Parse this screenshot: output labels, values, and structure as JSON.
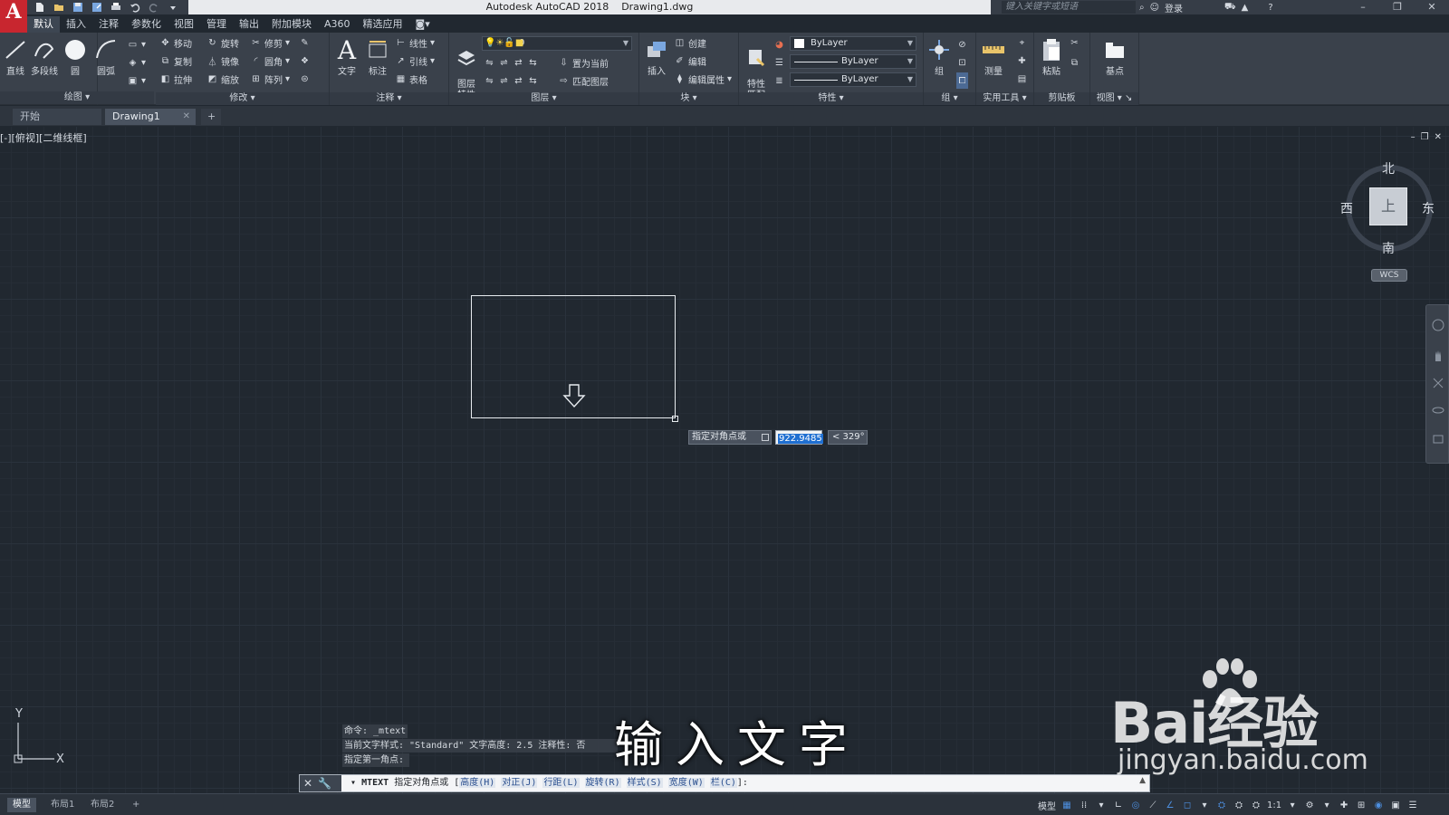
{
  "app": {
    "title": "Autodesk AutoCAD 2018",
    "file": "Drawing1.dwg",
    "logo_letter": "A",
    "search_placeholder": "键入关键字或短语",
    "login_label": "登录"
  },
  "ribbon_tabs": [
    "默认",
    "插入",
    "注释",
    "参数化",
    "视图",
    "管理",
    "输出",
    "附加模块",
    "A360",
    "精选应用"
  ],
  "ribbon": {
    "draw": {
      "title": "绘图",
      "line": "直线",
      "polyline": "多段线",
      "circle": "圆",
      "arc": "圆弧"
    },
    "modify": {
      "title": "修改",
      "move": "移动",
      "rotate": "旋转",
      "trim": "修剪",
      "copy": "复制",
      "mirror": "镜像",
      "fillet": "圆角",
      "stretch": "拉伸",
      "scale": "缩放",
      "array": "阵列"
    },
    "annotation": {
      "title": "注释",
      "text": "文字",
      "dimension": "标注",
      "linear": "线性",
      "leader": "引线",
      "table": "表格"
    },
    "layers": {
      "title": "图层",
      "layer_props": "图层\n特性",
      "current_layer": "0",
      "set_current": "置为当前",
      "match_layer": "匹配图层"
    },
    "block": {
      "title": "块",
      "insert": "插入",
      "create": "创建",
      "edit": "编辑",
      "edit_attr": "编辑属性"
    },
    "properties": {
      "title": "特性",
      "match": "特性\n匹配",
      "color": "ByLayer",
      "linetype": "ByLayer",
      "lineweight": "ByLayer"
    },
    "groups": {
      "title": "组",
      "group": "组"
    },
    "utilities": {
      "title": "实用工具",
      "measure": "测量"
    },
    "clipboard": {
      "title": "剪贴板",
      "paste": "粘贴"
    },
    "view": {
      "title": "视图",
      "base": "基点"
    }
  },
  "doc_tabs": {
    "start": "开始",
    "drawing": "Drawing1",
    "add": "+"
  },
  "viewport": {
    "label": "[-][俯视][二维线框]",
    "controls": [
      "–",
      "❐",
      "✕"
    ]
  },
  "dynamic_input": {
    "prompt": "指定对角点或",
    "value": "922.9485",
    "angle": "< 329°"
  },
  "viewcube": {
    "north": "北",
    "south": "南",
    "east": "东",
    "west": "西",
    "face": "上",
    "wcs": "WCS"
  },
  "ucs": {
    "x": "X",
    "y": "Y"
  },
  "command": {
    "history": [
      "命令: _mtext",
      "当前文字样式: \"Standard\"  文字高度: 2.5  注释性: 否",
      "指定第一角点:"
    ],
    "prefix": "MTEXT",
    "prompt": "指定对角点或",
    "options": [
      "高度(H)",
      "对正(J)",
      "行距(L)",
      "旋转(R)",
      "样式(S)",
      "宽度(W)",
      "栏(C)"
    ],
    "suffix": "]:"
  },
  "subtitle": "输入文字",
  "watermark": {
    "brand": "Bai经验",
    "url": "jingyan.baidu.com"
  },
  "status": {
    "tabs": [
      "模型",
      "布局1",
      "布局2",
      "+"
    ],
    "model_label": "模型",
    "scale": "1:1"
  },
  "colors": {
    "canvas_bg": "#212830",
    "ribbon_bg": "#3a414b",
    "logo_red": "#c8262f",
    "selection_blue": "#1f6fd1"
  }
}
